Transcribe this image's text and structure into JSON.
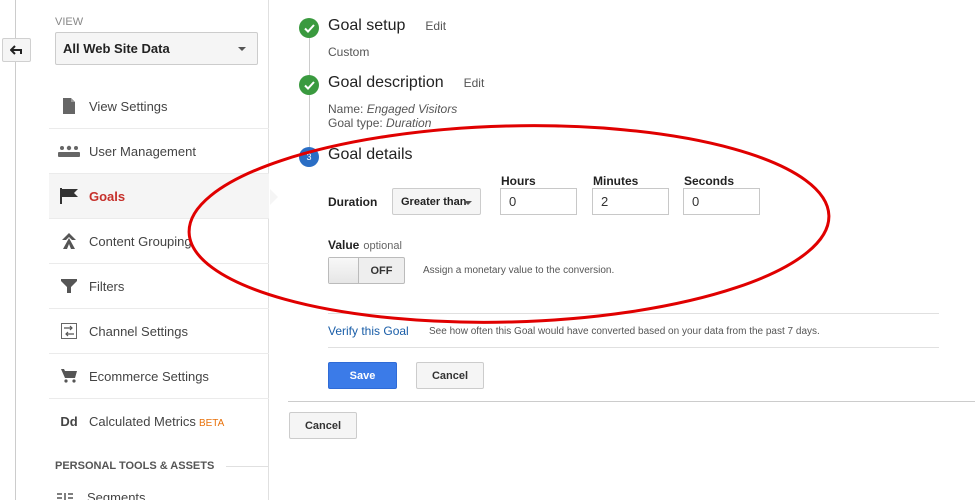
{
  "nav_back": {
    "icon": "back-arrow-icon"
  },
  "view": {
    "label": "VIEW",
    "selected": "All Web Site Data"
  },
  "sidebar": {
    "items": [
      {
        "label": "View Settings",
        "icon": "document-icon",
        "active": false
      },
      {
        "label": "User Management",
        "icon": "users-icon",
        "active": false
      },
      {
        "label": "Goals",
        "icon": "flag-icon",
        "active": true
      },
      {
        "label": "Content Grouping",
        "icon": "grouping-icon",
        "active": false
      },
      {
        "label": "Filters",
        "icon": "filter-icon",
        "active": false
      },
      {
        "label": "Channel Settings",
        "icon": "channel-icon",
        "active": false
      },
      {
        "label": "Ecommerce Settings",
        "icon": "cart-icon",
        "active": false
      },
      {
        "label": "Calculated Metrics",
        "badge": "BETA",
        "icon": "dd-icon",
        "icon_text": "Dd",
        "active": false
      }
    ],
    "section_title": "PERSONAL TOOLS & ASSETS",
    "section_items": [
      {
        "label": "Segments",
        "icon": "segments-icon"
      }
    ]
  },
  "steps": [
    {
      "number": "1",
      "status": "done",
      "title": "Goal setup",
      "edit": "Edit",
      "summary": "Custom"
    },
    {
      "number": "2",
      "status": "done",
      "title": "Goal description",
      "edit": "Edit",
      "name_label": "Name: ",
      "name_value": "Engaged Visitors",
      "type_label": "Goal type: ",
      "type_value": "Duration"
    },
    {
      "number": "3",
      "status": "current",
      "title": "Goal details"
    }
  ],
  "goal_details": {
    "duration_label": "Duration",
    "comparison": "Greater than",
    "hours_label": "Hours",
    "hours_value": "0",
    "minutes_label": "Minutes",
    "minutes_value": "2",
    "seconds_label": "Seconds",
    "seconds_value": "0",
    "value_label": "Value",
    "value_optional": "optional",
    "value_toggle": "OFF",
    "value_help": "Assign a monetary value to the conversion."
  },
  "verify": {
    "link": "Verify this Goal",
    "help": "See how often this Goal would have converted based on your data from the past 7 days."
  },
  "actions": {
    "save": "Save",
    "cancel": "Cancel",
    "outer_cancel": "Cancel"
  },
  "annotation": {
    "shape": "ellipse",
    "color": "#e00000"
  },
  "colors": {
    "active_nav": "#c6302b",
    "primary_button": "#3b7be8",
    "step_done": "#3a9a3f",
    "step_current": "#2a6ec5",
    "link": "#1a5ea8",
    "beta": "#e8710a"
  }
}
